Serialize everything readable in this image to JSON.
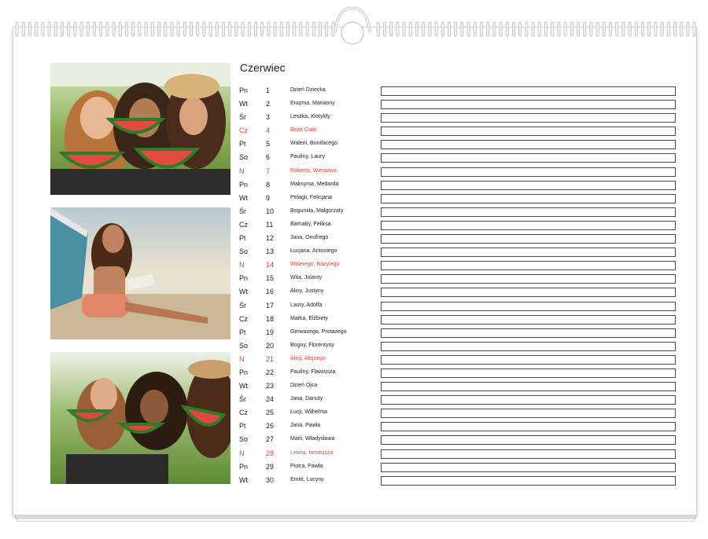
{
  "calendar": {
    "month": "Czerwiec",
    "colors": {
      "holiday": "#e63c3c",
      "text": "#222222",
      "box_border": "#4a4a4a"
    },
    "photos": [
      {
        "subject": "three women laughing eating watermelon in a park"
      },
      {
        "subject": "woman in hat reading a book on a beach"
      },
      {
        "subject": "three women eating watermelon on grass"
      }
    ],
    "days": [
      {
        "weekday": "Pn",
        "day": "1",
        "names": "Dzień Dziecka",
        "holiday": false
      },
      {
        "weekday": "Wt",
        "day": "2",
        "names": "Erazma, Marianny",
        "holiday": false
      },
      {
        "weekday": "Śr",
        "day": "3",
        "names": "Leszka, Klotyldy",
        "holiday": false
      },
      {
        "weekday": "Cz",
        "day": "4",
        "names": "Boże Ciało",
        "holiday": true
      },
      {
        "weekday": "Pt",
        "day": "5",
        "names": "Walerii, Bonifacego",
        "holiday": false
      },
      {
        "weekday": "So",
        "day": "6",
        "names": "Pauliny, Laury",
        "holiday": false
      },
      {
        "weekday": "N",
        "day": "7",
        "names": "Roberta, Wiesława",
        "holiday": true
      },
      {
        "weekday": "Pn",
        "day": "8",
        "names": "Maksyma, Medarda",
        "holiday": false
      },
      {
        "weekday": "Wt",
        "day": "9",
        "names": "Pelagii, Felicjana",
        "holiday": false
      },
      {
        "weekday": "Śr",
        "day": "10",
        "names": "Bogumiła, Małgorzaty",
        "holiday": false
      },
      {
        "weekday": "Cz",
        "day": "11",
        "names": "Barnaby, Feliksa",
        "holiday": false
      },
      {
        "weekday": "Pt",
        "day": "12",
        "names": "Jana, Onufrego",
        "holiday": false
      },
      {
        "weekday": "So",
        "day": "13",
        "names": "Łucjana, Antoniego",
        "holiday": false
      },
      {
        "weekday": "N",
        "day": "14",
        "names": "Walerego, Bazylego",
        "holiday": true
      },
      {
        "weekday": "Pn",
        "day": "15",
        "names": "Wita, Jolanty",
        "holiday": false
      },
      {
        "weekday": "Wt",
        "day": "16",
        "names": "Aliny, Justyny",
        "holiday": false
      },
      {
        "weekday": "Śr",
        "day": "17",
        "names": "Laury, Adolfa",
        "holiday": false
      },
      {
        "weekday": "Cz",
        "day": "18",
        "names": "Marka, Elżbiety",
        "holiday": false
      },
      {
        "weekday": "Pt",
        "day": "19",
        "names": "Gerwazego, Protazego",
        "holiday": false
      },
      {
        "weekday": "So",
        "day": "20",
        "names": "Bogny, Florentyny",
        "holiday": false
      },
      {
        "weekday": "N",
        "day": "21",
        "names": "Alicji, Alojzego",
        "holiday": true
      },
      {
        "weekday": "Pn",
        "day": "22",
        "names": "Pauliny, Flawiusza",
        "holiday": false
      },
      {
        "weekday": "Wt",
        "day": "23",
        "names": "Dzień Ojca",
        "holiday": false
      },
      {
        "weekday": "Śr",
        "day": "24",
        "names": "Jana, Danuty",
        "holiday": false
      },
      {
        "weekday": "Cz",
        "day": "25",
        "names": "Łucji, Wilhelma",
        "holiday": false
      },
      {
        "weekday": "Pt",
        "day": "26",
        "names": "Jana, Pawła",
        "holiday": false
      },
      {
        "weekday": "So",
        "day": "27",
        "names": "Marii, Władysława",
        "holiday": false
      },
      {
        "weekday": "N",
        "day": "28",
        "names": "Leona, Ireneusza",
        "holiday": true
      },
      {
        "weekday": "Pn",
        "day": "29",
        "names": "Piotra, Pawła",
        "holiday": false
      },
      {
        "weekday": "Wt",
        "day": "30",
        "names": "Emilii, Lucyny",
        "holiday": false
      }
    ]
  }
}
